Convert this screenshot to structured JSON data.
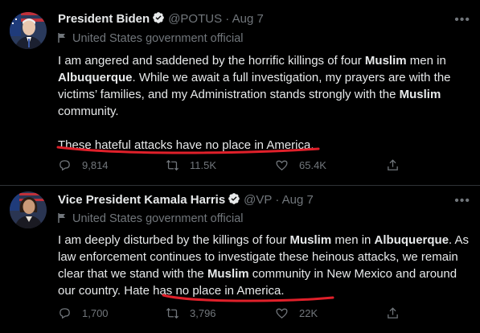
{
  "tweets": [
    {
      "name": "President Biden",
      "handle": "@POTUS",
      "separator": "·",
      "date": "Aug 7",
      "label": "United States government official",
      "more_icon": "more-horizontal-icon",
      "body_segments": [
        {
          "text": "I am angered and saddened by the horrific killings of four ",
          "bold": false
        },
        {
          "text": "Muslim",
          "bold": true
        },
        {
          "text": " men in ",
          "bold": false
        },
        {
          "text": "Albuquerque",
          "bold": true
        },
        {
          "text": ". While we await a full investigation, my prayers are with the victims’ families, and my Administration stands strongly with the ",
          "bold": false
        },
        {
          "text": "Muslim",
          "bold": true
        },
        {
          "text": " community.",
          "bold": false
        }
      ],
      "body_second": "These hateful attacks have no place in America.",
      "replies": "9,814",
      "retweets": "11.5K",
      "likes": "65.4K"
    },
    {
      "name": "Vice President Kamala Harris",
      "handle": "@VP",
      "separator": "·",
      "date": "Aug 7",
      "label": "United States government official",
      "more_icon": "more-horizontal-icon",
      "body_segments": [
        {
          "text": "I am deeply disturbed by the killings of four ",
          "bold": false
        },
        {
          "text": "Muslim",
          "bold": true
        },
        {
          "text": " men in ",
          "bold": false
        },
        {
          "text": "Albuquerque",
          "bold": true
        },
        {
          "text": ". As law enforcement continues to investigate these heinous attacks, we remain clear that we stand with the ",
          "bold": false
        },
        {
          "text": "Muslim",
          "bold": true
        },
        {
          "text": " community in New Mexico and around our country. Hate has no place in America.",
          "bold": false
        }
      ],
      "replies": "1,700",
      "retweets": "3,796",
      "likes": "22K"
    }
  ],
  "colors": {
    "background": "#000000",
    "text": "#e7e9ea",
    "muted": "#71767b",
    "verified": "#1d9bf0",
    "underline": "#e0202a"
  }
}
